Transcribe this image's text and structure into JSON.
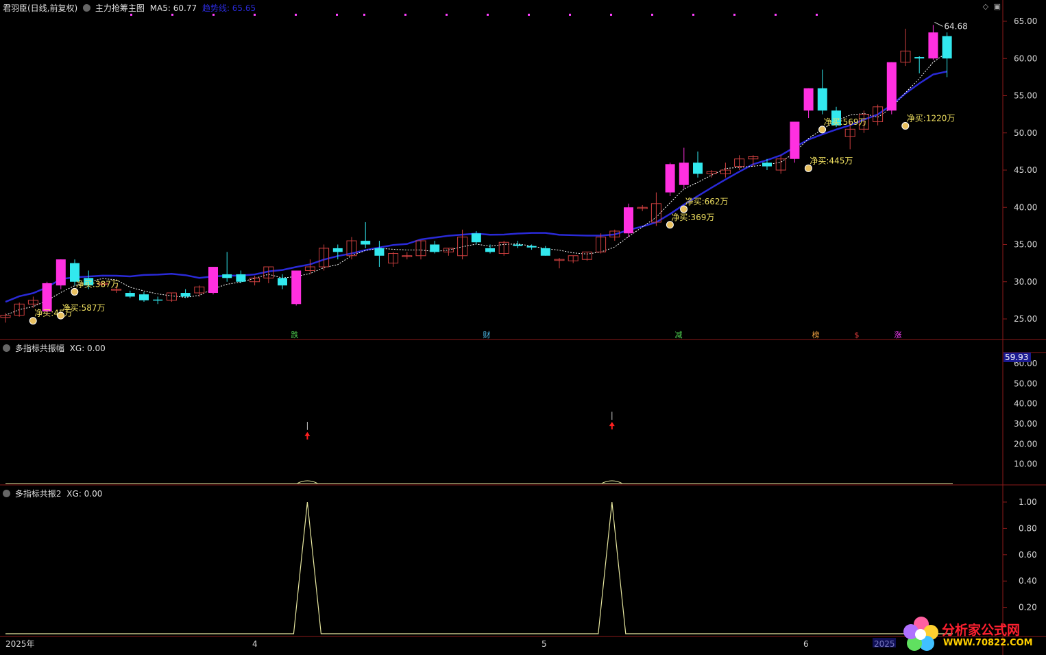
{
  "colors": {
    "background": "#000000",
    "up_candle": "#ff30e0",
    "up_candle_small": "#d04040",
    "down_candle": "#32e8ee",
    "ma_line": "#2a2ad8",
    "dotted_line": "#ffffff",
    "annotation": "#f0e060",
    "panel_divider": "#8b1a1a",
    "axis_text": "#d8d8d8",
    "resonance_line": "#e8e8a0",
    "signal_arrow": "#ff2020"
  },
  "header": {
    "stock": "君羽臣(日线,前复权)",
    "indicator": "主力抢筹主图",
    "ma5": "MA5: 60.77",
    "trend": "趋势线: 65.65"
  },
  "panel2": {
    "title": "多指标共振幅",
    "xg": "XG: 0.00",
    "current": "59.93"
  },
  "panel3": {
    "title": "多指标共振2",
    "xg": "XG: 0.00"
  },
  "price_axis": [
    "65.00",
    "60.00",
    "55.00",
    "50.00",
    "45.00",
    "40.00",
    "35.00",
    "30.00",
    "25.00"
  ],
  "amp_axis": [
    "60.00",
    "50.00",
    "40.00",
    "30.00",
    "20.00",
    "10.00"
  ],
  "res_axis": [
    "1.00",
    "0.80",
    "0.60",
    "0.40",
    "0.20"
  ],
  "date_axis": [
    "2025年",
    "4",
    "5",
    "6",
    "2025"
  ],
  "event_markers": [
    {
      "label": "跌",
      "color": "#50d050"
    },
    {
      "label": "财",
      "color": "#50c0f0"
    },
    {
      "label": "减",
      "color": "#50d050"
    },
    {
      "label": "榜",
      "color": "#f0a040"
    },
    {
      "label": "$",
      "color": "#f04040"
    },
    {
      "label": "涨",
      "color": "#ff40ff"
    }
  ],
  "buy_labels": [
    {
      "text": "净买:45万"
    },
    {
      "text": "净买:587万"
    },
    {
      "text": "净买:387万"
    },
    {
      "text": "净买:369万"
    },
    {
      "text": "净买:662万"
    },
    {
      "text": "净买:445万"
    },
    {
      "text": "净买:569万"
    },
    {
      "text": "净买:1220万"
    }
  ],
  "price_high": "64.68",
  "logo": {
    "brand": "分析家公式网",
    "url": "WWW.70822.COM"
  },
  "chart_data": [
    {
      "type": "candlestick",
      "title": "主力抢筹主图",
      "ylim": [
        22,
        67
      ],
      "candles": [
        [
          25.2,
          25.8,
          24.5,
          25.5
        ],
        [
          25.5,
          27.2,
          25.3,
          27.0
        ],
        [
          27.0,
          28.0,
          26.5,
          27.5
        ],
        [
          26.0,
          30.0,
          25.5,
          29.8
        ],
        [
          29.5,
          33.0,
          29.0,
          33.0
        ],
        [
          32.5,
          33.0,
          29.5,
          30.0
        ],
        [
          30.5,
          31.5,
          29.0,
          29.5
        ],
        [
          29.8,
          29.9,
          29.5,
          29.8
        ],
        [
          29.0,
          29.5,
          28.5,
          29.0
        ],
        [
          28.5,
          28.8,
          27.8,
          28.0
        ],
        [
          28.3,
          28.6,
          27.3,
          27.5
        ],
        [
          27.6,
          28.0,
          27.0,
          27.5
        ],
        [
          27.5,
          28.5,
          27.3,
          28.5
        ],
        [
          28.5,
          29.0,
          27.8,
          28.0
        ],
        [
          28.5,
          29.5,
          28.0,
          29.3
        ],
        [
          28.5,
          32.0,
          28.3,
          32.0
        ],
        [
          31.0,
          34.0,
          30.0,
          30.5
        ],
        [
          31.0,
          31.5,
          29.8,
          30.0
        ],
        [
          30.0,
          30.8,
          29.5,
          30.5
        ],
        [
          30.5,
          32.0,
          29.8,
          32.0
        ],
        [
          30.5,
          31.0,
          29.0,
          29.5
        ],
        [
          27.0,
          31.5,
          26.8,
          31.5
        ],
        [
          31.5,
          33.0,
          31.0,
          32.0
        ],
        [
          32.0,
          35.0,
          31.5,
          34.5
        ],
        [
          34.5,
          35.0,
          33.0,
          34.0
        ],
        [
          33.5,
          36.0,
          33.0,
          35.5
        ],
        [
          35.5,
          38.0,
          34.5,
          35.0
        ],
        [
          34.5,
          35.5,
          32.0,
          33.5
        ],
        [
          32.5,
          34.0,
          32.0,
          33.8
        ],
        [
          33.5,
          34.0,
          33.0,
          33.5
        ],
        [
          33.5,
          35.5,
          33.0,
          35.5
        ],
        [
          35.0,
          35.5,
          33.8,
          34.0
        ],
        [
          34.0,
          34.5,
          33.5,
          34.5
        ],
        [
          33.5,
          37.0,
          33.0,
          36.0
        ],
        [
          36.5,
          36.8,
          35.0,
          35.3
        ],
        [
          34.5,
          35.0,
          33.8,
          34.0
        ],
        [
          33.8,
          35.5,
          33.5,
          35.3
        ],
        [
          35.0,
          35.5,
          34.5,
          34.8
        ],
        [
          34.8,
          35.0,
          34.3,
          34.6
        ],
        [
          34.5,
          34.8,
          33.5,
          33.5
        ],
        [
          33.0,
          33.2,
          31.8,
          33.0
        ],
        [
          32.8,
          33.5,
          32.5,
          33.5
        ],
        [
          33.0,
          34.0,
          32.8,
          34.0
        ],
        [
          34.0,
          36.5,
          33.8,
          36.0
        ],
        [
          36.0,
          37.0,
          35.5,
          36.8
        ],
        [
          36.5,
          40.5,
          36.0,
          40.0
        ],
        [
          39.8,
          40.3,
          39.5,
          40.0
        ],
        [
          38.0,
          42.0,
          37.5,
          40.5
        ],
        [
          42.0,
          46.0,
          41.5,
          45.8
        ],
        [
          43.0,
          48.0,
          42.5,
          46.0
        ],
        [
          46.0,
          47.5,
          44.0,
          44.5
        ],
        [
          44.5,
          45.0,
          44.0,
          44.8
        ],
        [
          44.5,
          46.0,
          44.0,
          45.0
        ],
        [
          45.5,
          47.0,
          45.0,
          46.5
        ],
        [
          46.5,
          47.0,
          45.5,
          46.8
        ],
        [
          46.0,
          46.5,
          45.0,
          45.5
        ],
        [
          45.0,
          47.0,
          44.5,
          46.5
        ],
        [
          46.5,
          51.5,
          46.0,
          51.5
        ],
        [
          53.0,
          56.0,
          52.0,
          56.0
        ],
        [
          56.0,
          58.5,
          52.5,
          53.0
        ],
        [
          53.0,
          53.5,
          50.8,
          51.0
        ],
        [
          49.5,
          51.5,
          47.8,
          50.5
        ],
        [
          50.5,
          53.0,
          50.0,
          52.5
        ],
        [
          51.5,
          53.8,
          51.0,
          53.5
        ],
        [
          53.0,
          59.5,
          52.5,
          59.5
        ],
        [
          59.5,
          64.0,
          59.0,
          61.0
        ],
        [
          60.2,
          60.3,
          58.0,
          60.0
        ],
        [
          60.0,
          64.5,
          59.8,
          63.5
        ],
        [
          63.0,
          63.5,
          57.5,
          60.0
        ]
      ],
      "ma_line": "趋势线",
      "ma5_value": 60.77,
      "trend_value": 65.65
    },
    {
      "type": "line",
      "title": "多指标共振幅",
      "ylim": [
        0,
        65
      ],
      "spikes": [
        {
          "candle": 22,
          "value": 31
        },
        {
          "candle": 44,
          "value": 36
        }
      ]
    },
    {
      "type": "line",
      "title": "多指标共振2",
      "ylim": [
        0,
        1.1
      ],
      "peaks": [
        {
          "candle": 22,
          "value": 1.0
        },
        {
          "candle": 44,
          "value": 1.0
        }
      ]
    }
  ]
}
